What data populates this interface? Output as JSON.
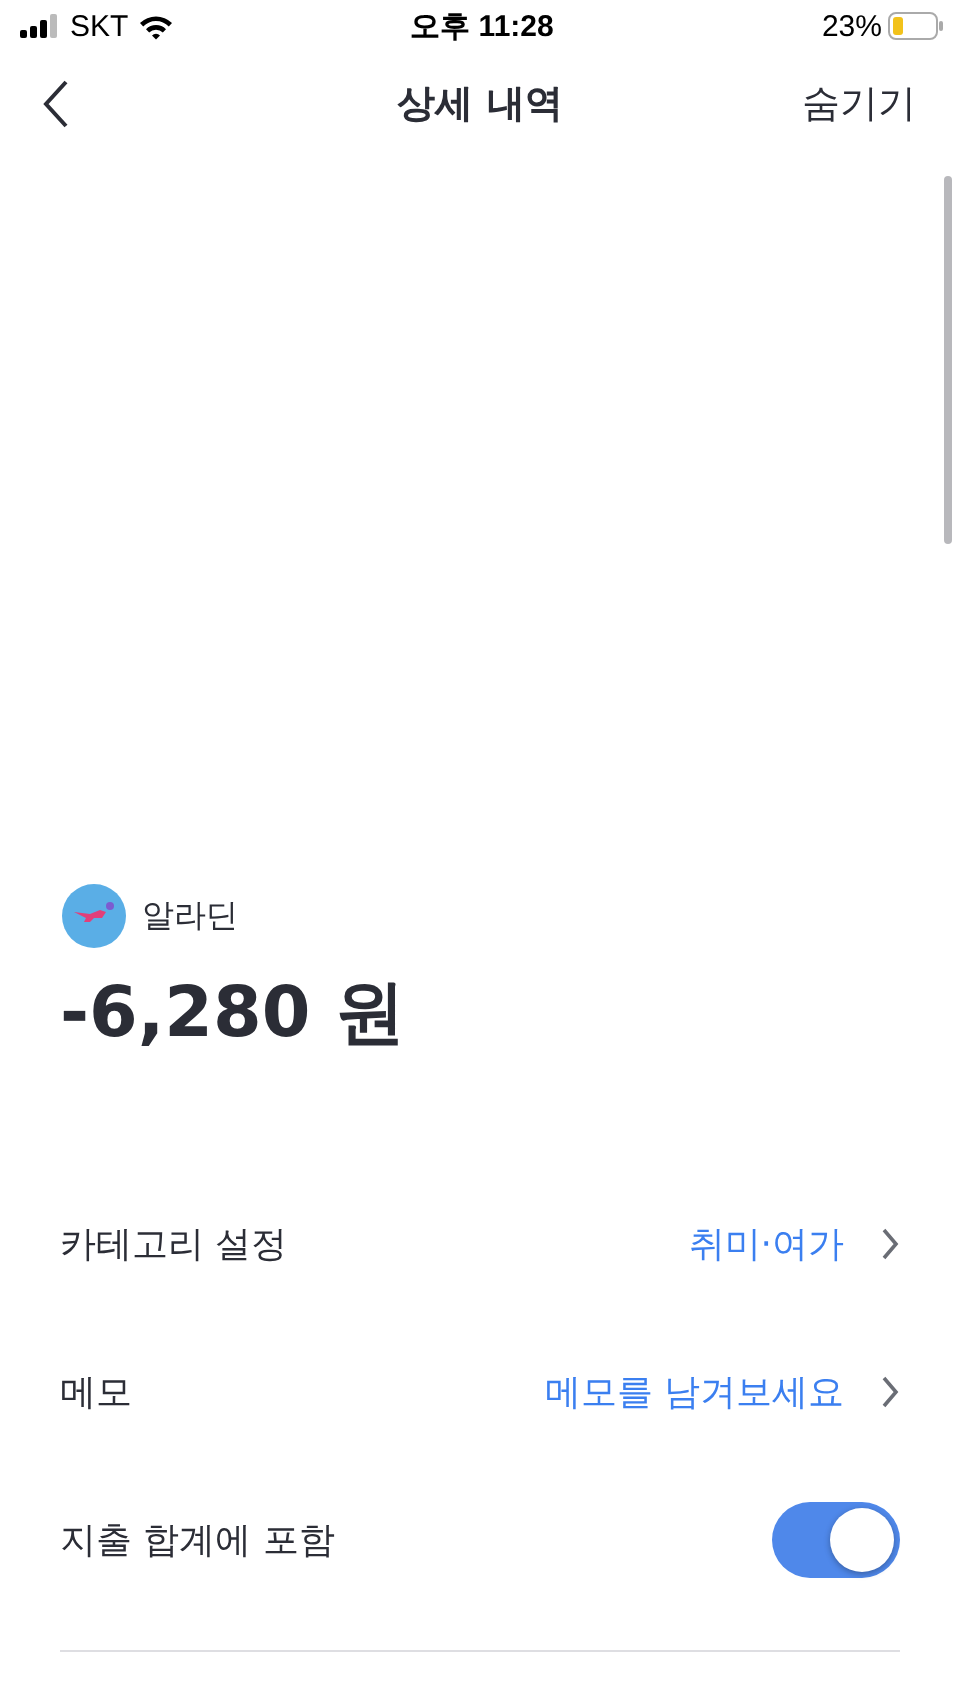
{
  "status_bar": {
    "carrier": "SKT",
    "time": "오후 11:28",
    "battery": "23%"
  },
  "nav": {
    "title": "상세 내역",
    "action": "숨기기"
  },
  "merchant": {
    "name": "알라딘"
  },
  "amount": "-6,280 원",
  "rows": [
    {
      "kind": "link",
      "label": "카테고리 설정",
      "value": "취미·여가"
    },
    {
      "kind": "link",
      "label": "메모",
      "value": "메모를 남겨보세요"
    },
    {
      "kind": "toggle",
      "label": "지출 합계에 포함",
      "on": true
    }
  ]
}
